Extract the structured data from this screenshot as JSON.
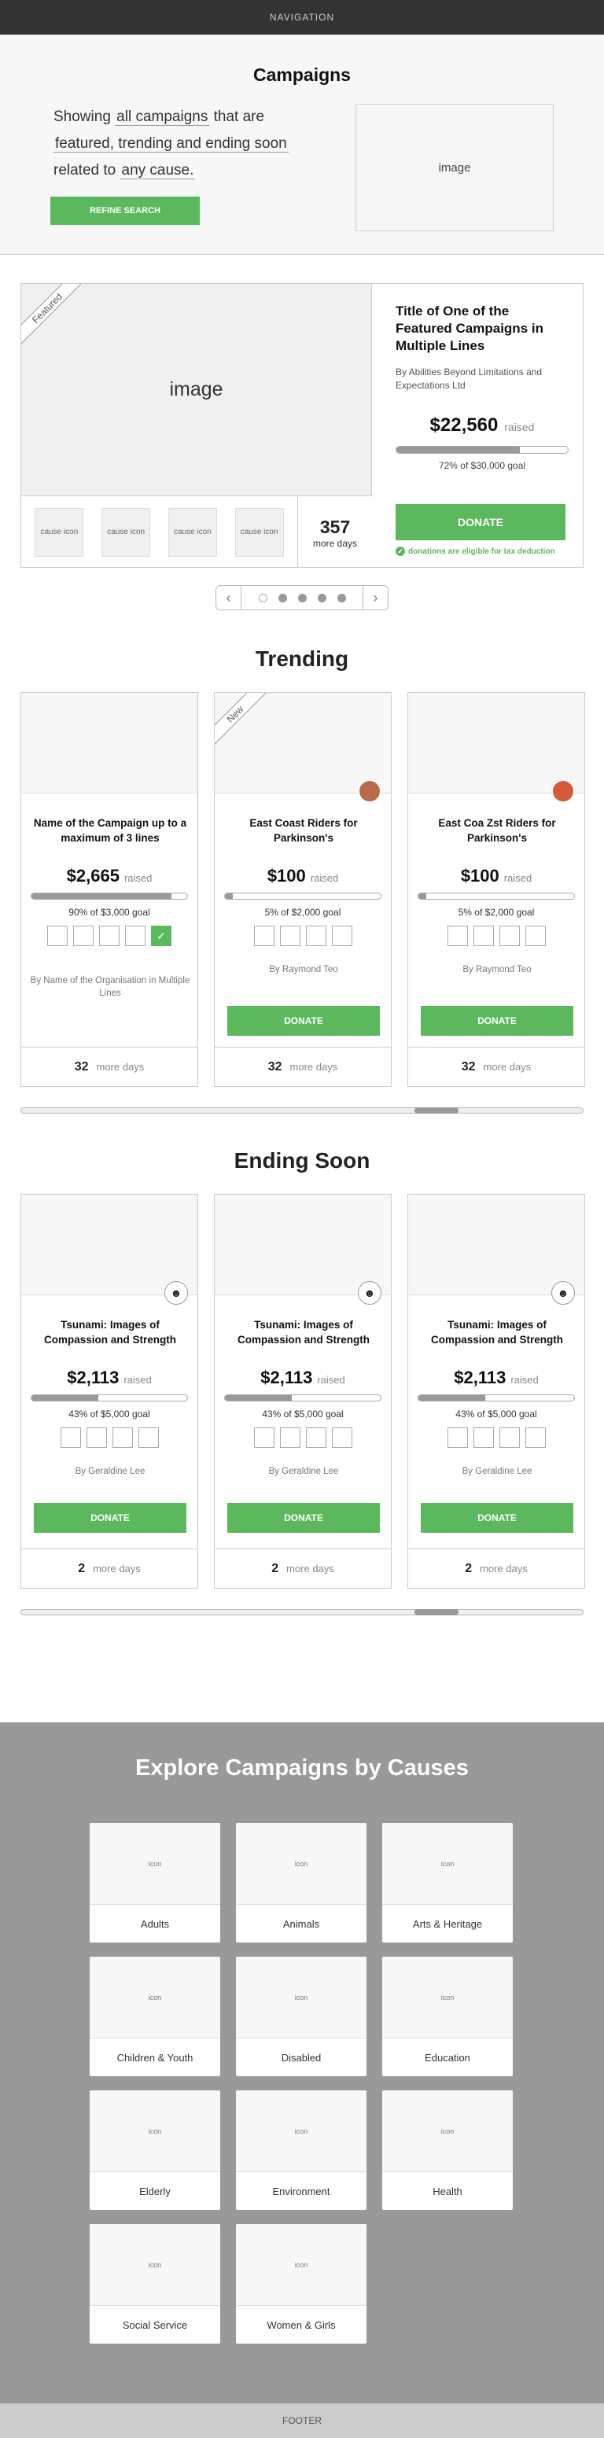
{
  "nav": {
    "label": "NAVIGATION"
  },
  "hero": {
    "title": "Campaigns",
    "desc_showing": "Showing",
    "filter_1": "all campaigns",
    "desc_that_are": "that are",
    "filter_2": "featured, trending and ending soon",
    "desc_related": "related to",
    "filter_3": "any cause.",
    "refine_label": "REFINE SEARCH",
    "image_label": "image"
  },
  "featured": {
    "ribbon": "Featured",
    "image_label": "image",
    "title": "Title of One of the Featured Campaigns in Multiple Lines",
    "org": "By Abilities Beyond Limitations and Expectations Ltd",
    "amount": "$22,560",
    "raised_label": "raised",
    "progress": 0.72,
    "goal_text": "72% of $30,000 goal",
    "donate_label": "DONATE",
    "tax_note": "donations are eligible for tax deduction",
    "causes": [
      "cause icon",
      "cause icon",
      "cause icon",
      "cause icon"
    ],
    "days_num": "357",
    "days_label": "more days"
  },
  "pager": {
    "prev": "‹",
    "next": "›",
    "pages": 5,
    "active_index": 0
  },
  "trending": {
    "title": "Trending",
    "cards": [
      {
        "title": "Name of the Campaign up to a maximum of 3 lines",
        "amount": "$2,665",
        "raised_label": "raised",
        "progress": 0.9,
        "goal": "90% of $3,000 goal",
        "org": "By Name of the Organisation in Multiple Lines",
        "days": "32",
        "days_label": "more days"
      },
      {
        "ribbon": "New",
        "title": "East Coast Riders for Parkinson's",
        "amount": "$100",
        "raised_label": "raised",
        "progress": 0.05,
        "goal": "5% of $2,000 goal",
        "org": "By Raymond Teo",
        "donate": "DONATE",
        "days": "32",
        "days_label": "more days"
      },
      {
        "title": "East Coa Zst Riders for Parkinson's",
        "amount": "$100",
        "raised_label": "raised",
        "progress": 0.05,
        "goal": "5% of $2,000 goal",
        "org": "By Raymond Teo",
        "donate": "DONATE",
        "days": "32",
        "days_label": "more days"
      }
    ]
  },
  "ending": {
    "title": "Ending Soon",
    "cards": [
      {
        "title": "Tsunami: Images of Compassion and Strength",
        "amount": "$2,113",
        "raised_label": "raised",
        "progress": 0.43,
        "goal": "43% of $5,000 goal",
        "org": "By Geraldine Lee",
        "donate": "DONATE",
        "days": "2",
        "days_label": "more days"
      },
      {
        "title": "Tsunami: Images of Compassion and Strength",
        "amount": "$2,113",
        "raised_label": "raised",
        "progress": 0.43,
        "goal": "43% of $5,000 goal",
        "org": "By Geraldine Lee",
        "donate": "DONATE",
        "days": "2",
        "days_label": "more days"
      },
      {
        "title": "Tsunami: Images of Compassion and Strength",
        "amount": "$2,113",
        "raised_label": "raised",
        "progress": 0.43,
        "goal": "43% of $5,000 goal",
        "org": "By Geraldine Lee",
        "donate": "DONATE",
        "days": "2",
        "days_label": "more days"
      }
    ]
  },
  "explore": {
    "title": "Explore Campaigns by Causes",
    "icon_label": "icon",
    "causes": [
      "Adults",
      "Animals",
      "Arts & Heritage",
      "Children & Youth",
      "Disabled",
      "Education",
      "Elderly",
      "Environment",
      "Health",
      "Social Service",
      "Women & Girls"
    ]
  },
  "footer": {
    "label": "FOOTER"
  },
  "colors": {
    "accent": "#5cb85c",
    "nav_bg": "#333333",
    "explore_bg": "#999999"
  }
}
